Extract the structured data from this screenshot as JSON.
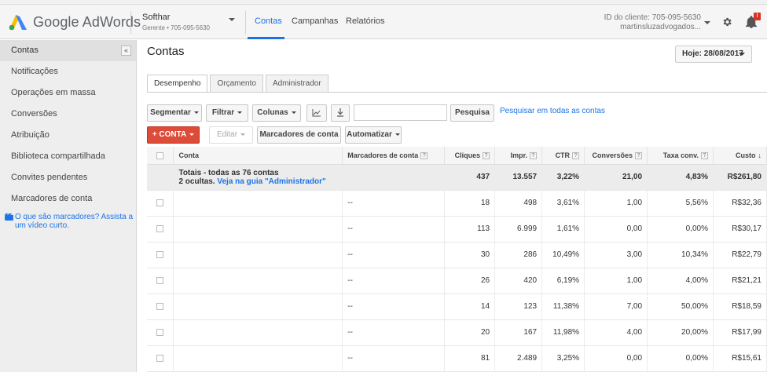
{
  "header": {
    "logo_text": "Google AdWords",
    "account_name": "Softhar",
    "account_sub": "Gerente • 705-095-5630",
    "nav": [
      "Contas",
      "Campanhas",
      "Relatórios"
    ],
    "client_id": "ID do cliente: 705-095-5630",
    "client_email": "martinsluzadvogados...",
    "notification_count": "!"
  },
  "sidebar": {
    "items": [
      "Contas",
      "Notificações",
      "Operações em massa",
      "Conversões",
      "Atribuição",
      "Biblioteca compartilhada",
      "Convites pendentes",
      "Marcadores de conta"
    ],
    "collapse": "«",
    "help_text": "O que são marcadores? Assista a um vídeo curto."
  },
  "main": {
    "title": "Contas",
    "date_button": "Hoje: 28/08/2017",
    "tabs": [
      "Desempenho",
      "Orçamento",
      "Administrador"
    ],
    "toolbar": {
      "segmentar": "Segmentar",
      "filtrar": "Filtrar",
      "colunas": "Colunas",
      "search_button": "Pesquisa",
      "search_all_link": "Pesquisar em todas as contas",
      "conta_button": "CONTA",
      "editar": "Editar",
      "marcadores": "Marcadores de conta",
      "automatizar": "Automatizar"
    }
  },
  "table": {
    "headers": [
      "Conta",
      "Marcadores de conta",
      "Cliques",
      "Impr.",
      "CTR",
      "Conversões",
      "Taxa conv.",
      "Custo"
    ],
    "help_glyph": "?",
    "sort_glyph": "↓",
    "total": {
      "label": "Totais - todas as 76 contas",
      "hidden_prefix": "2 ocultas. ",
      "hidden_link": "Veja na guia \"Administrador\"",
      "cliques": "437",
      "impr": "13.557",
      "ctr": "3,22%",
      "conversoes": "21,00",
      "taxa": "4,83%",
      "custo": "R$261,80"
    },
    "rows": [
      {
        "conta": "",
        "marcadores": "--",
        "cliques": "18",
        "impr": "498",
        "ctr": "3,61%",
        "conversoes": "1,00",
        "taxa": "5,56%",
        "custo": "R$32,36"
      },
      {
        "conta": "",
        "marcadores": "--",
        "cliques": "113",
        "impr": "6.999",
        "ctr": "1,61%",
        "conversoes": "0,00",
        "taxa": "0,00%",
        "custo": "R$30,17"
      },
      {
        "conta": "",
        "marcadores": "--",
        "cliques": "30",
        "impr": "286",
        "ctr": "10,49%",
        "conversoes": "3,00",
        "taxa": "10,34%",
        "custo": "R$22,79"
      },
      {
        "conta": "",
        "marcadores": "--",
        "cliques": "26",
        "impr": "420",
        "ctr": "6,19%",
        "conversoes": "1,00",
        "taxa": "4,00%",
        "custo": "R$21,21"
      },
      {
        "conta": "",
        "marcadores": "--",
        "cliques": "14",
        "impr": "123",
        "ctr": "11,38%",
        "conversoes": "7,00",
        "taxa": "50,00%",
        "custo": "R$18,59"
      },
      {
        "conta": "",
        "marcadores": "--",
        "cliques": "20",
        "impr": "167",
        "ctr": "11,98%",
        "conversoes": "4,00",
        "taxa": "20,00%",
        "custo": "R$17,99"
      },
      {
        "conta": "",
        "marcadores": "--",
        "cliques": "81",
        "impr": "2.489",
        "ctr": "3,25%",
        "conversoes": "0,00",
        "taxa": "0,00%",
        "custo": "R$15,61"
      }
    ]
  },
  "colors": {
    "accent": "#1a73e8",
    "red_button": "#dd4b39",
    "logo_blue": "#4285f4",
    "logo_yellow": "#fbbc04",
    "logo_green": "#34a853"
  }
}
